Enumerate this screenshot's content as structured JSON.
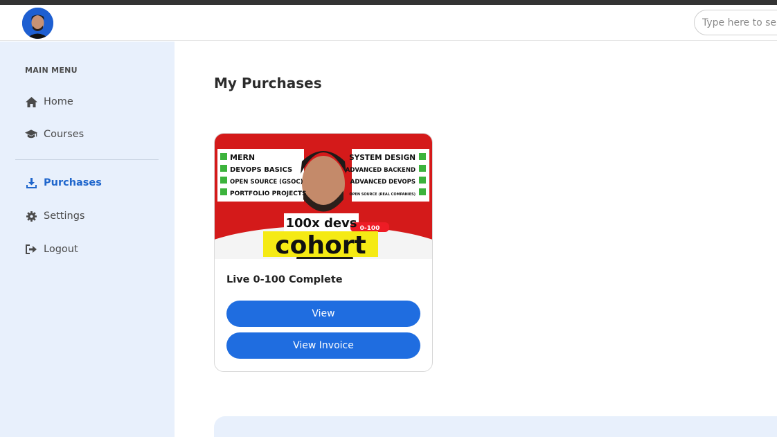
{
  "header": {
    "search_placeholder": "Type here to search"
  },
  "sidebar": {
    "menu_title": "MAIN MENU",
    "items": [
      {
        "label": "Home",
        "icon": "home-icon"
      },
      {
        "label": "Courses",
        "icon": "graduation-cap-icon"
      },
      {
        "label": "Purchases",
        "icon": "download-icon",
        "active": true
      },
      {
        "label": "Settings",
        "icon": "gear-icon"
      },
      {
        "label": "Logout",
        "icon": "logout-icon"
      }
    ]
  },
  "main": {
    "title": "My Purchases",
    "purchases": [
      {
        "title": "Live 0-100 Complete",
        "view_label": "View",
        "invoice_label": "View Invoice",
        "thumbnail": {
          "left_list": [
            "MERN",
            "DEVOPS BASICS",
            "OPEN SOURCE (GSOC)",
            "PORTFOLIO PROJECTS"
          ],
          "right_list": [
            "SYSTEM DESIGN",
            "ADVANCED BACKEND",
            "ADVANCED DEVOPS",
            "OPEN SOURCE (REAL COMPANIES)"
          ],
          "brand": "100x devs",
          "badge": "0-100",
          "headline": "cohort"
        }
      }
    ]
  },
  "colors": {
    "accent": "#1f6de0",
    "sidebar_bg": "#e8f0fc",
    "active_nav": "#1f66cc",
    "thumbnail_red": "#d41a1a",
    "headline_yellow": "#f5ea14"
  }
}
